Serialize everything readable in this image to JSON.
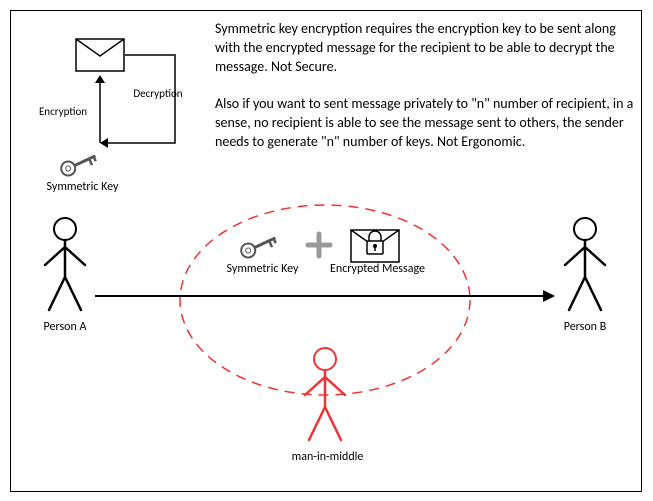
{
  "description": {
    "para1": "Symmetric key encryption requires the encryption key to be sent along with the encrypted message for the recipient to be able to decrypt the message. Not Secure.",
    "para2": "Also if you want to sent message privately to \"n\" number of recipient, in a sense, no recipient is able to see the message sent to others, the sender needs to generate \"n\" number of keys. Not Ergonomic."
  },
  "labels": {
    "encryption": "Encryption",
    "decryption": "Decryption",
    "symmetric_key_top": "Symmetric Key",
    "symmetric_key_mid": "Symmetric Key",
    "encrypted_message": "Encrypted Message",
    "person_a": "Person A",
    "person_b": "Person B",
    "man_in_middle": "man-in-middle"
  }
}
